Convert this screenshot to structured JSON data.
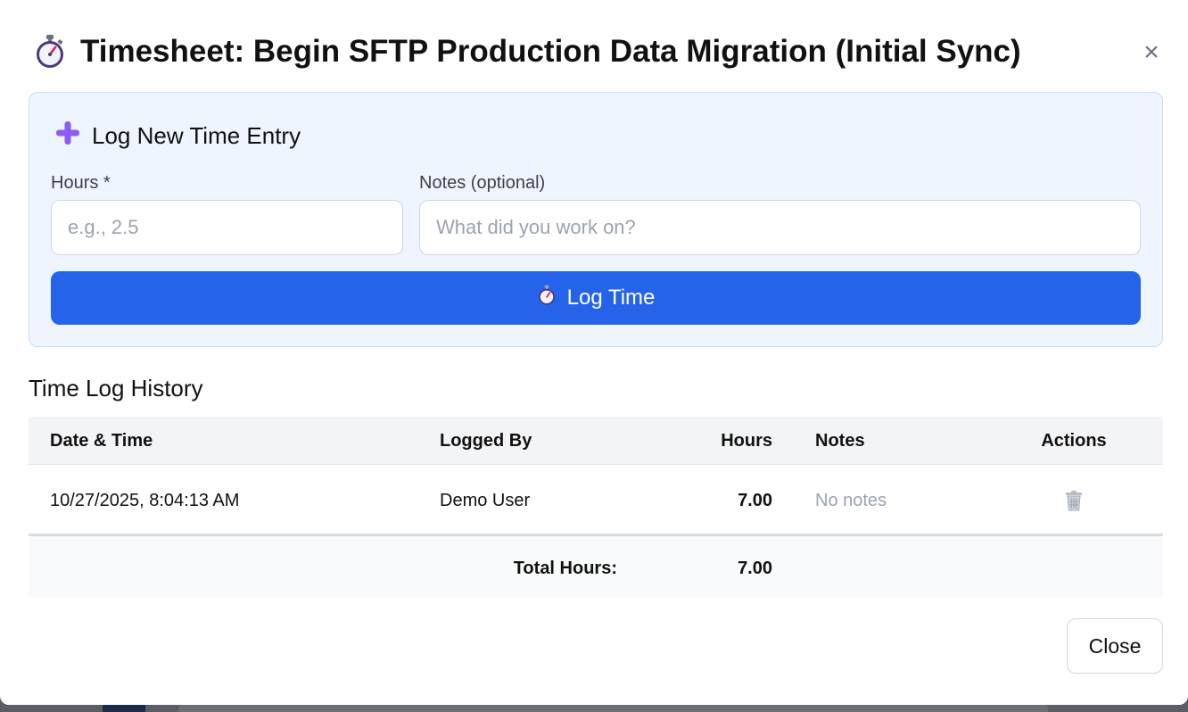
{
  "modal": {
    "title": "Timesheet: Begin SFTP Production Data Migration (Initial Sync)",
    "title_icon": "stopwatch-icon",
    "close_icon": "close-icon",
    "close_glyph": "×"
  },
  "entry_form": {
    "heading": "Log New Time Entry",
    "heading_icon": "plus-icon",
    "hours_label": "Hours *",
    "hours_placeholder": "e.g., 2.5",
    "hours_value": "",
    "notes_label": "Notes (optional)",
    "notes_placeholder": "What did you work on?",
    "notes_value": "",
    "submit_label": "Log Time",
    "submit_icon": "stopwatch-icon"
  },
  "history": {
    "title": "Time Log History",
    "columns": [
      "Date & Time",
      "Logged By",
      "Hours",
      "Notes",
      "Actions"
    ],
    "rows": [
      {
        "date_time": "10/27/2025, 8:04:13 AM",
        "logged_by": "Demo User",
        "hours": "7.00",
        "notes": "No notes",
        "action_icon": "trash-icon"
      }
    ],
    "total_label": "Total Hours:",
    "total_value": "7.00"
  },
  "footer": {
    "close_label": "Close"
  },
  "colors": {
    "primary": "#2563eb",
    "panel_bg": "#eef5ff",
    "plus_icon": "#8b5cf6",
    "stopwatch_accent": "#e11d48"
  }
}
